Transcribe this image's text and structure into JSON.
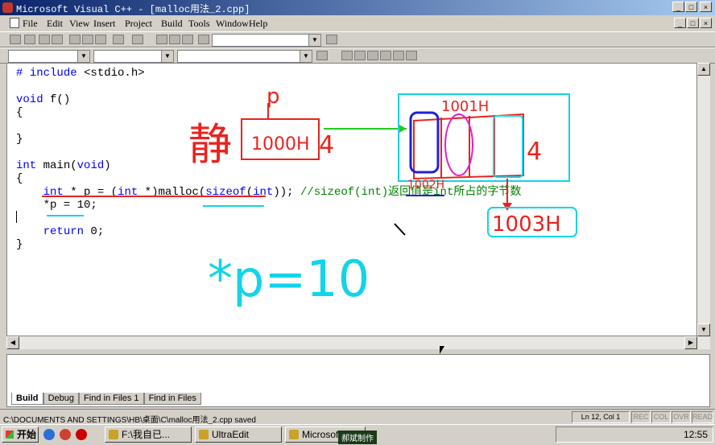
{
  "window": {
    "title": "Microsoft Visual C++ - [malloc用法_2.cpp]"
  },
  "menubar": {
    "items": [
      "File",
      "Edit",
      "View",
      "Insert",
      "Project",
      "Build",
      "Tools",
      "Window",
      "Help"
    ]
  },
  "code_lines": [
    "# include <stdio.h>",
    "",
    "void f()",
    "{",
    "",
    "}",
    "",
    "int main(void)",
    "{",
    "    int * p = (int *)malloc(sizeof(int)); //sizeof(int)返回值是int所占的字节数",
    "    *p = 10;",
    "",
    "    return 0;",
    "}"
  ],
  "annotations": {
    "p_label": "p",
    "address_1": "1000H",
    "size_4": "4",
    "address_top": "1001H",
    "address_bottom": "1002H",
    "address_result": "1003H",
    "big_expr": "*p=10",
    "static_char": "静"
  },
  "output_tabs": [
    "Build",
    "Debug",
    "Find in Files 1",
    "Find in Files"
  ],
  "status": {
    "path": "C:\\DOCUMENTS AND SETTINGS\\HB\\桌面\\C\\malloc用法_2.cpp saved",
    "position": "Ln 12, Col 1",
    "indicators": [
      "REC",
      "COL",
      "OVR",
      "READ"
    ]
  },
  "taskbar": {
    "start_label": "开始",
    "tasks": [
      "F:\\我自已...",
      "UltraEdit",
      "Microsoft..."
    ],
    "clock": "12:55"
  },
  "watermark": "郝斌制作",
  "colors": {
    "title_start": "#0a246a",
    "red_ink": "#e8231f",
    "cyan_ink": "#12d4e8",
    "blue_ink": "#1e22d6",
    "magenta_ink": "#e020d0",
    "green_ink": "#22cc22"
  }
}
